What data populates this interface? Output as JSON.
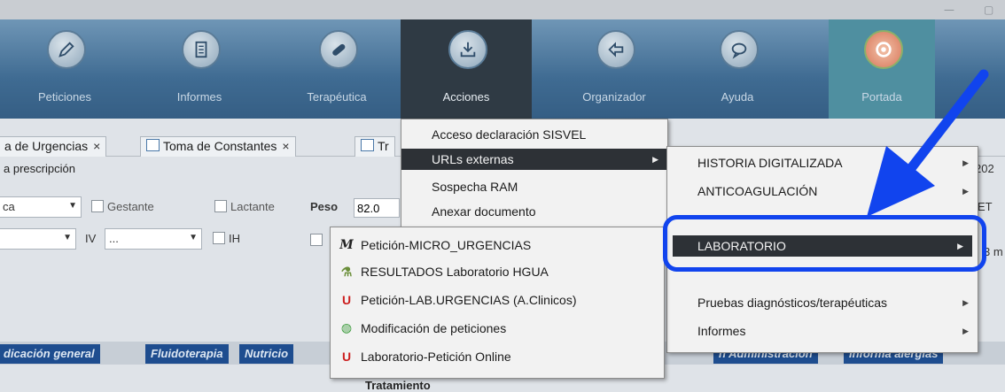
{
  "toolbar": {
    "buttons": [
      {
        "label": "Peticiones",
        "icon": "pencil-icon"
      },
      {
        "label": "Informes",
        "icon": "document-icon"
      },
      {
        "label": "Terapéutica",
        "icon": "pill-icon"
      },
      {
        "label": "Acciones",
        "icon": "download-tray-icon"
      },
      {
        "label": "Organizador",
        "icon": "back-arrow-icon"
      },
      {
        "label": "Ayuda",
        "icon": "speech-bubble-icon"
      },
      {
        "label": "Portada",
        "icon": "lifebuoy-icon"
      }
    ]
  },
  "tabs": {
    "tab1": "a de Urgencias",
    "tab2": "Toma de Constantes",
    "tab3": "Tr",
    "close": "×"
  },
  "subtitle": "a prescripción",
  "form": {
    "combo1": "ca",
    "gestante": "Gestante",
    "lactante": "Lactante",
    "peso_label": "Peso",
    "peso_value": "82.0",
    "iv_label": "IV",
    "iv_value": "...",
    "ih_label": "IH",
    "right_fragment_1": "ET",
    "right_fragment_2": "3 m",
    "year_fragment": "202"
  },
  "acciones_menu": {
    "items": [
      {
        "label": "Acceso declaración SISVEL"
      },
      {
        "label": "URLs externas",
        "has_submenu": true
      },
      {
        "label": "Sospecha RAM"
      },
      {
        "label": "Anexar documento"
      }
    ]
  },
  "urls_menu": {
    "items": [
      {
        "label": "HISTORIA DIGITALIZADA",
        "has_submenu": true
      },
      {
        "label": "ANTICOAGULACIÓN",
        "has_submenu": true
      },
      {
        "label": "LABORATORIO",
        "has_submenu": true
      },
      {
        "label": "Pruebas diagnósticos/terapéuticas",
        "has_submenu": true
      },
      {
        "label": "Informes",
        "has_submenu": true
      }
    ]
  },
  "lab_menu": {
    "items": [
      {
        "label": "Petición-MICRO_URGENCIAS",
        "icon": "m-letter-icon"
      },
      {
        "label": "RESULTADOS Laboratorio HGUA",
        "icon": "flask-icon"
      },
      {
        "label": "Petición-LAB.URGENCIAS (A.Clinicos)",
        "icon": "u-letter-icon"
      },
      {
        "label": "Modificación de peticiones",
        "icon": "globe-icon"
      },
      {
        "label": "Laboratorio-Petición Online",
        "icon": "u-letter-icon"
      }
    ]
  },
  "bottom_tabs": {
    "t1": "dicación general",
    "t2": "Fluidoterapia",
    "t3": "Nutricio",
    "t4": "n Administración",
    "t5": "Informa alergias"
  },
  "section_title": "Tratamiento",
  "colors": {
    "toolbar_bg": "#3f6b92",
    "active_button": "#2f3a44",
    "menu_selected": "#2d3136",
    "callout": "#1144ee"
  }
}
